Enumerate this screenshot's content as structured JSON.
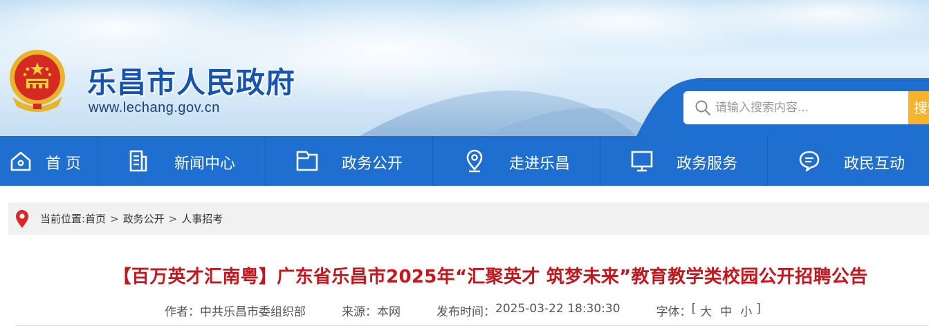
{
  "header": {
    "site_title": "乐昌市人民政府",
    "site_url": "www.lechang.gov.cn",
    "emblem_icon": "national-emblem-icon",
    "search": {
      "placeholder": "请输入搜索内容...",
      "button_label": "搜索",
      "icon": "search-icon"
    }
  },
  "nav": {
    "items": [
      {
        "label": "首 页",
        "icon": "home-icon"
      },
      {
        "label": "新闻中心",
        "icon": "news-icon"
      },
      {
        "label": "政务公开",
        "icon": "folder-icon"
      },
      {
        "label": "走进乐昌",
        "icon": "location-icon"
      },
      {
        "label": "政务服务",
        "icon": "monitor-icon"
      },
      {
        "label": "政民互动",
        "icon": "chat-icon"
      }
    ]
  },
  "breadcrumb": {
    "prefix": "当前位置:",
    "items": [
      "首页",
      "政务公开",
      "人事招考"
    ],
    "separator": ">",
    "icon": "map-pin-icon"
  },
  "article": {
    "title": "【百万英才汇南粤】广东省乐昌市2025年“汇聚英才 筑梦未来”教育教学类校园公开招聘公告",
    "author_label": "作者：",
    "author": "中共乐昌市委组织部",
    "source_label": "来源：",
    "source": "本网",
    "published_label": "发布时间：",
    "published": "2025-03-22 18:30:30",
    "font_label": "字体：",
    "font_open": "[",
    "font_sizes": [
      "大",
      "中",
      "小"
    ],
    "font_close": "]"
  },
  "colors": {
    "nav_bg": "#1e6fcf",
    "title_red": "#c4161c",
    "brand_blue": "#1554b0",
    "search_btn": "#f7b32a"
  }
}
